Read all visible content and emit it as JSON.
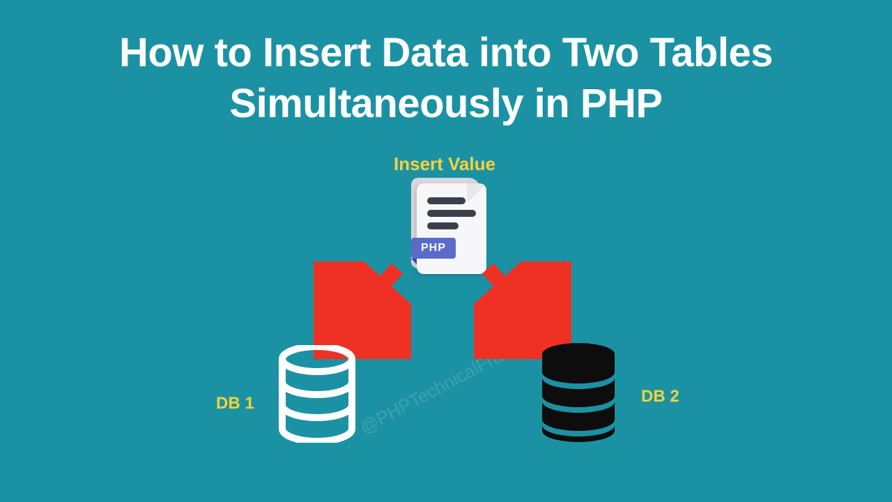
{
  "title": "How to Insert Data into Two Tables Simultaneously in PHP",
  "insert_label": "Insert Value",
  "php_badge": "PHP",
  "db1_label": "DB 1",
  "db2_label": "DB 2",
  "watermark": "@PHPTechnicalFramework",
  "colors": {
    "background": "#1b92a3",
    "title": "#ffffff",
    "accent": "#f5d33b",
    "arrow": "#ee3124",
    "php_badge": "#5a6bc9",
    "db_outline": "#ffffff",
    "db_solid": "#0d0d0d"
  }
}
